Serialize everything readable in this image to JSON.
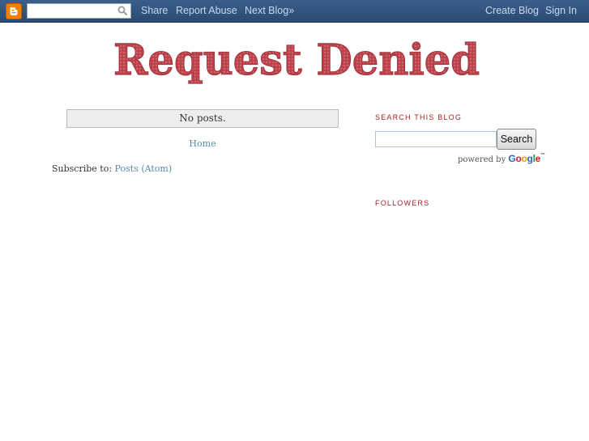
{
  "navbar": {
    "search_value": "",
    "share": "Share",
    "report_abuse": "Report Abuse",
    "next_blog": "Next Blog»",
    "create_blog": "Create Blog",
    "sign_in": "Sign In"
  },
  "header": {
    "title": "Request Denied",
    "title_color": "#c0454e"
  },
  "main": {
    "no_posts": "No posts.",
    "home": "Home",
    "subscribe_label": "Subscribe to: ",
    "subscribe_link": "Posts (Atom)"
  },
  "sidebar": {
    "search_heading": "Search This Blog",
    "search_value": "",
    "search_button": "Search",
    "powered_by": "powered by",
    "google": [
      "G",
      "o",
      "o",
      "g",
      "l",
      "e"
    ],
    "google_tm": "™",
    "followers_heading": "Followers"
  },
  "colors": {
    "navbar": "#2f5180",
    "nav_link": "#c9d8ee",
    "link": "#5588aa",
    "heading": "#aa2222"
  }
}
